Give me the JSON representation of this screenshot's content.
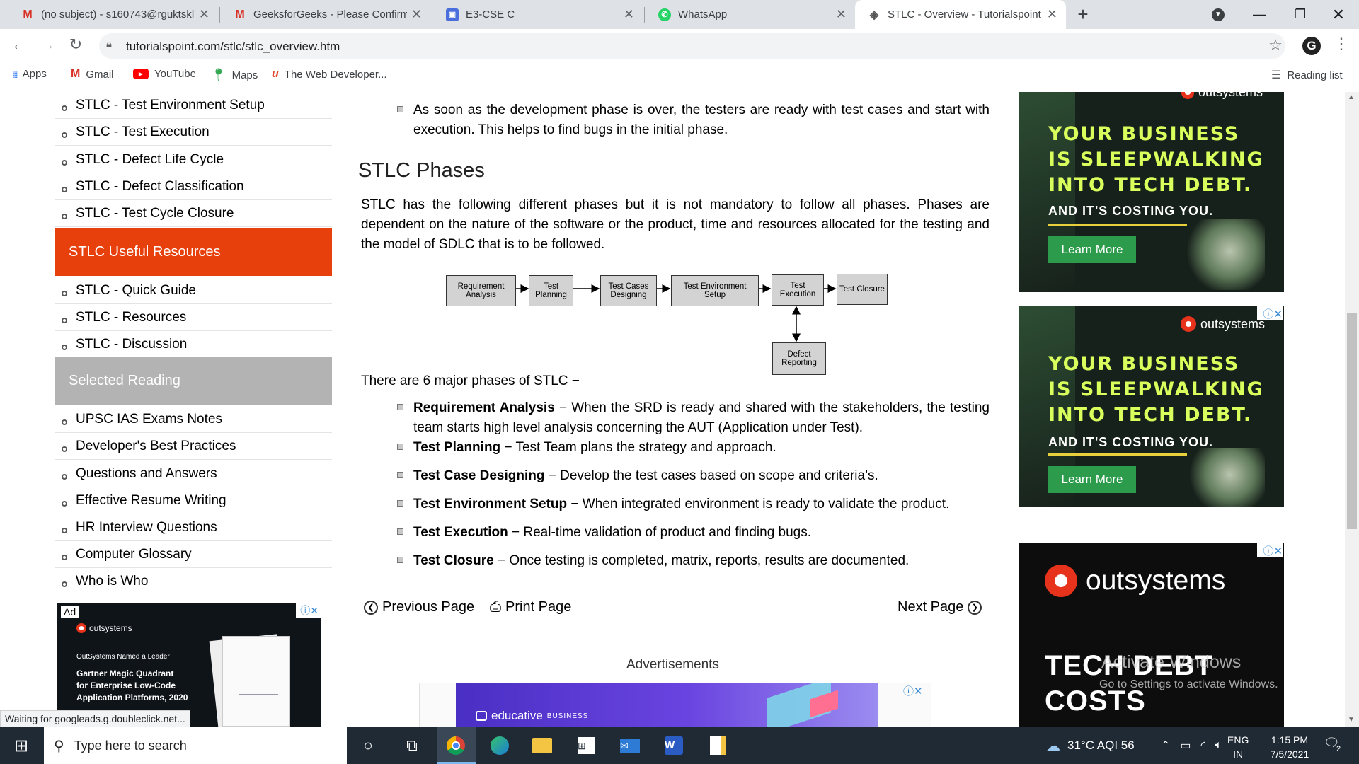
{
  "browser": {
    "tabs": [
      {
        "title": "(no subject) - s160743@rguktskl",
        "icon": "gmail-icon"
      },
      {
        "title": "GeeksforGeeks - Please Confirm",
        "icon": "gmail-icon"
      },
      {
        "title": "E3-CSE C",
        "icon": "classroom-icon"
      },
      {
        "title": "WhatsApp",
        "icon": "whatsapp-icon"
      },
      {
        "title": "STLC - Overview - Tutorialspoint",
        "icon": "tutorialspoint-icon",
        "active": true
      }
    ],
    "url": "tutorialspoint.com/stlc/stlc_overview.htm",
    "bookmarks": [
      "Apps",
      "Gmail",
      "YouTube",
      "Maps",
      "The Web Developer..."
    ],
    "reading_list": "Reading list",
    "status_text": "Waiting for googleads.g.doubleclick.net..."
  },
  "sidebar": {
    "links_top": [
      "STLC - Test Environment Setup",
      "STLC - Test Execution",
      "STLC - Defect Life Cycle",
      "STLC - Defect Classification",
      "STLC - Test Cycle Closure"
    ],
    "resources_heading": "STLC Useful Resources",
    "resources": [
      "STLC - Quick Guide",
      "STLC - Resources",
      "STLC - Discussion"
    ],
    "selected_heading": "Selected Reading",
    "selected": [
      "UPSC IAS Exams Notes",
      "Developer's Best Practices",
      "Questions and Answers",
      "Effective Resume Writing",
      "HR Interview Questions",
      "Computer Glossary",
      "Who is Who"
    ],
    "ad": {
      "label": "Ad",
      "brand": "outsystems",
      "line1": "OutSystems Named a Leader",
      "line2": "Gartner Magic Quadrant",
      "line3": "for Enterprise Low-Code",
      "line4": "Application Platforms, 2020"
    }
  },
  "main": {
    "intro_bullet": "As soon as the development phase is over, the testers are ready with test cases and start with execution. This helps to find bugs in the initial phase.",
    "heading": "STLC Phases",
    "paragraph": "STLC has the following different phases but it is not mandatory to follow all phases. Phases are dependent on the nature of the software or the product, time and resources allocated for the testing and the model of SDLC that is to be followed.",
    "diagram": {
      "boxes": [
        "Requirement Analysis",
        "Test Planning",
        "Test Cases Designing",
        "Test Environment Setup",
        "Test Execution",
        "Test Closure",
        "Defect Reporting"
      ]
    },
    "phases_intro": "There are 6 major phases of STLC −",
    "phases": [
      {
        "term": "Requirement Analysis",
        "desc": " − When the SRD is ready and shared with the stakeholders, the testing team starts high level analysis concerning the AUT (Application under Test)."
      },
      {
        "term": "Test Planning",
        "desc": " − Test Team plans the strategy and approach."
      },
      {
        "term": "Test Case Designing",
        "desc": " − Develop the test cases based on scope and criteria’s."
      },
      {
        "term": "Test Environment Setup",
        "desc": " − When integrated environment is ready to validate the product."
      },
      {
        "term": "Test Execution",
        "desc": " − Real-time validation of product and finding bugs."
      },
      {
        "term": "Test Closure",
        "desc": " − Once testing is completed, matrix, reports, results are documented."
      }
    ],
    "prev_label": "Previous Page",
    "print_label": "Print Page",
    "next_label": "Next Page",
    "advertisements_label": "Advertisements",
    "bottom_ad_brand": "educative",
    "bottom_ad_sub": "BUSINESS"
  },
  "right_ads": {
    "brand": "outsystems",
    "headline": [
      "YOUR BUSINESS",
      "IS SLEEPWALKING",
      "INTO TECH DEBT."
    ],
    "sub": "AND IT'S COSTING YOU.",
    "cta": "Learn More",
    "ad3_headline": [
      "TECH DEBT",
      "COSTS"
    ]
  },
  "watermark": {
    "line1": "Activate Windows",
    "line2": "Go to Settings to activate Windows."
  },
  "taskbar": {
    "search_placeholder": "Type here to search",
    "weather": "31°C  AQI 56",
    "lang1": "ENG",
    "lang2": "IN",
    "time": "1:15 PM",
    "date": "7/5/2021",
    "notif_count": "2"
  }
}
